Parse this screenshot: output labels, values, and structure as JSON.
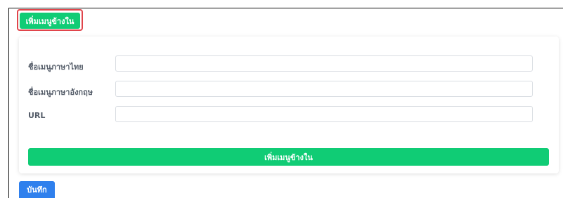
{
  "toolbar": {
    "add_submenu_label": "เพิ่มเมนูข้างใน"
  },
  "form": {
    "fields": [
      {
        "label": "ชื่อเมนูภาษาไทย",
        "value": ""
      },
      {
        "label": "ชื่อเมนูภาษาอังกฤษ",
        "value": ""
      },
      {
        "label": "URL",
        "value": ""
      }
    ],
    "add_submenu_label": "เพิ่มเมนูข้างใน"
  },
  "footer": {
    "save_label": "บันทึก"
  },
  "colors": {
    "success": "#10cc75",
    "primary": "#2f80ed",
    "highlight": "#e0454b"
  }
}
